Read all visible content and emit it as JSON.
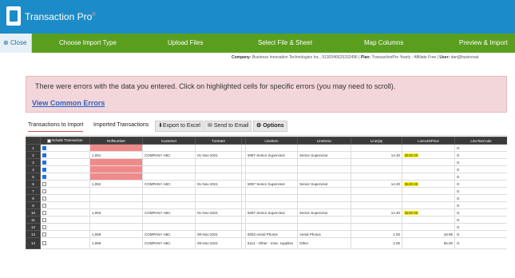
{
  "app": {
    "title": "Transaction Pro",
    "title_mark": "®"
  },
  "nav": {
    "close_label": "Close",
    "steps": [
      "Choose Import Type",
      "Upload Files",
      "Select File & Sheet",
      "Map Columns",
      "Preview & Import"
    ]
  },
  "company": {
    "label": "Company:",
    "value": "Business Innovation Technologies Inc., 9130346625332496",
    "plan_label": "Plan:",
    "plan_value": "TransactionPro Yearly - Affiliate Free",
    "user_label": "User:",
    "user_value": "dan@businovat"
  },
  "error": {
    "message": "There were errors with the data you entered. Click on highlighted cells for specific errors (you may need to scroll).",
    "link": "View Common Errors"
  },
  "tabs": {
    "items": [
      "Transactions to Import",
      "Imported Transactions"
    ],
    "export_label": "Export to Excel",
    "email_label": "Send to Email",
    "options_label": "Options"
  },
  "grid": {
    "columns": [
      "",
      "Include Transaction",
      "RefNumber",
      "Customer",
      "TxnDate",
      "",
      "LineItem",
      "LineDesc",
      "LineQty",
      "LineUnitPrice",
      "LineTaxCode"
    ],
    "rows": [
      {
        "n": "1",
        "checked": true,
        "ref": "",
        "customer": "",
        "date": "",
        "item": "",
        "desc": "",
        "qty": "",
        "price": "",
        "tax": "G",
        "err": true,
        "hl": false
      },
      {
        "n": "2",
        "checked": true,
        "ref": "1,051",
        "customer": "COMPANY ABC",
        "date": "01-Nov-2021",
        "item": "6087 Senior Supervisor",
        "desc": "Senior Supervisor",
        "qty": "14.30",
        "price": "$100.00",
        "tax": "G",
        "err": false,
        "hl": true
      },
      {
        "n": "3",
        "checked": true,
        "ref": "",
        "customer": "",
        "date": "",
        "item": "",
        "desc": "",
        "qty": "",
        "price": "",
        "tax": "G",
        "err": true,
        "hl": false
      },
      {
        "n": "4",
        "checked": true,
        "ref": "",
        "customer": "",
        "date": "",
        "item": "",
        "desc": "",
        "qty": "",
        "price": "",
        "tax": "G",
        "err": true,
        "hl": false
      },
      {
        "n": "5",
        "checked": true,
        "ref": "",
        "customer": "",
        "date": "",
        "item": "",
        "desc": "",
        "qty": "",
        "price": "",
        "tax": "G",
        "err": true,
        "hl": false
      },
      {
        "n": "6",
        "checked": false,
        "ref": "1,052",
        "customer": "COMPANY ABC",
        "date": "01-Nov-2021",
        "item": "6087 Senior Supervisor",
        "desc": "Senior Supervisor",
        "qty": "14.30",
        "price": "$100.00",
        "tax": "G",
        "err": false,
        "hl": true
      },
      {
        "n": "7",
        "checked": false,
        "ref": "",
        "customer": "",
        "date": "",
        "item": "",
        "desc": "",
        "qty": "",
        "price": "",
        "tax": "G",
        "err": false,
        "hl": false
      },
      {
        "n": "8",
        "checked": false,
        "ref": "",
        "customer": "",
        "date": "",
        "item": "",
        "desc": "",
        "qty": "",
        "price": "",
        "tax": "G",
        "err": false,
        "hl": false
      },
      {
        "n": "9",
        "checked": false,
        "ref": "",
        "customer": "",
        "date": "",
        "item": "",
        "desc": "",
        "qty": "",
        "price": "",
        "tax": "G",
        "err": false,
        "hl": false
      },
      {
        "n": "10",
        "checked": false,
        "ref": "1,053",
        "customer": "COMPANY ABC",
        "date": "01-Nov-2021",
        "item": "6087 Senior Supervisor",
        "desc": "Senior Supervisor",
        "qty": "14.30",
        "price": "$100.00",
        "tax": "G",
        "err": false,
        "hl": true
      },
      {
        "n": "11",
        "checked": false,
        "ref": "",
        "customer": "",
        "date": "",
        "item": "",
        "desc": "",
        "qty": "",
        "price": "",
        "tax": "G",
        "err": false,
        "hl": false
      },
      {
        "n": "12",
        "checked": false,
        "ref": "",
        "customer": "",
        "date": "",
        "item": "",
        "desc": "",
        "qty": "",
        "price": "",
        "tax": "G",
        "err": false,
        "hl": false
      },
      {
        "n": "13",
        "checked": false,
        "ref": "1,059",
        "customer": "COMPANY ABC",
        "date": "08-Nov-2021",
        "item": "6053 Aerial Photos",
        "desc": "Aerial Photos",
        "qty": "1.00",
        "price": "18.98",
        "tax": "G",
        "err": false,
        "hl": false
      },
      {
        "n": "14",
        "checked": false,
        "ref": "1,059",
        "customer": "COMPANY ABC",
        "date": "08-Nov-2021",
        "item": "6114 - Other - misc. supplies",
        "desc": "Other",
        "qty": "2.00",
        "price": "55.00",
        "tax": "G",
        "err": false,
        "hl": false
      }
    ]
  },
  "colors": {
    "topbar": "#1b8cc7",
    "navbar": "#5a9e1f",
    "error_bg": "#f3d6d9",
    "error_cell": "#f08a8a",
    "highlight": "#f7f20a"
  }
}
